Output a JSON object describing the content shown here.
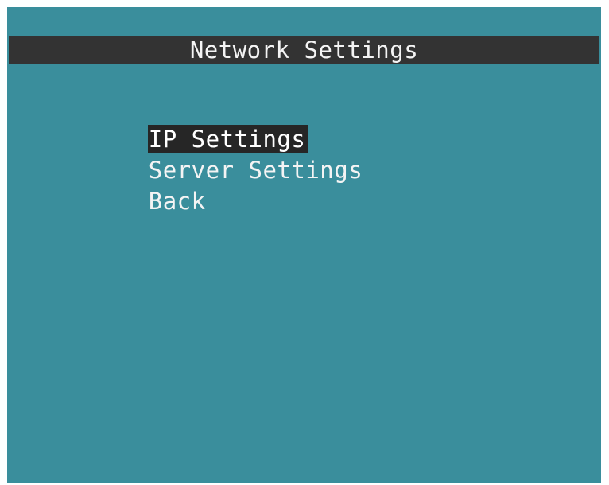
{
  "screen": {
    "title": "Network Settings",
    "background_color": "#3a8e9c",
    "title_bar_color": "#333333",
    "selection_color": "#262626"
  },
  "menu": {
    "items": [
      {
        "label": "IP Settings",
        "selected": true
      },
      {
        "label": "Server Settings",
        "selected": false
      },
      {
        "label": "Back",
        "selected": false
      }
    ]
  }
}
